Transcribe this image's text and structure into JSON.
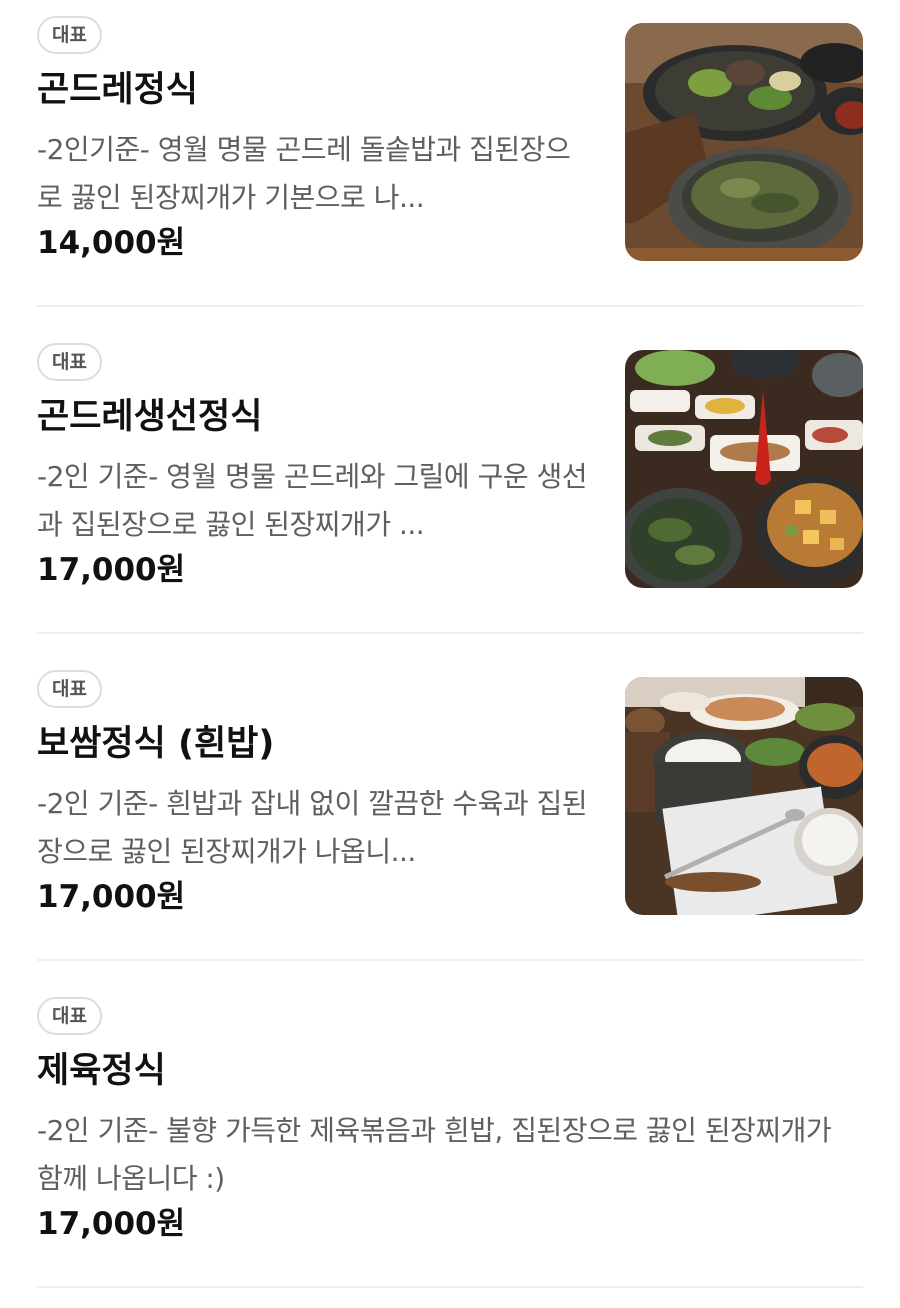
{
  "menu": {
    "items": [
      {
        "badge": "대표",
        "name": "곤드레정식",
        "description": "-2인기준- 영월 명물 곤드레 돌솥밥과 집된장으로 끓인 된장찌개가 기본으로 나...",
        "price": "14,000원",
        "photo": "food-photo"
      },
      {
        "badge": "대표",
        "name": "곤드레생선정식",
        "description": "-2인 기준- 영월 명물 곤드레와 그릴에 구운 생선과 집된장으로 끓인 된장찌개가 ...",
        "price": "17,000원",
        "photo": "food-photo"
      },
      {
        "badge": "대표",
        "name": "보쌈정식 (흰밥)",
        "description": "-2인 기준- 흰밥과 잡내 없이 깔끔한 수육과 집된장으로 끓인 된장찌개가 나옵니...",
        "price": "17,000원",
        "photo": "food-photo"
      },
      {
        "badge": "대표",
        "name": "제육정식",
        "description": "-2인 기준- 불향 가득한 제육볶음과 흰밥, 집된장으로 끓인 된장찌개가 함께 나옵니다 :)",
        "price": "17,000원"
      }
    ]
  },
  "colors": {
    "text": "#111111",
    "description": "#5f5f5f",
    "badge_border": "#dcdcdc",
    "divider": "#efefef",
    "background": "#ffffff"
  }
}
